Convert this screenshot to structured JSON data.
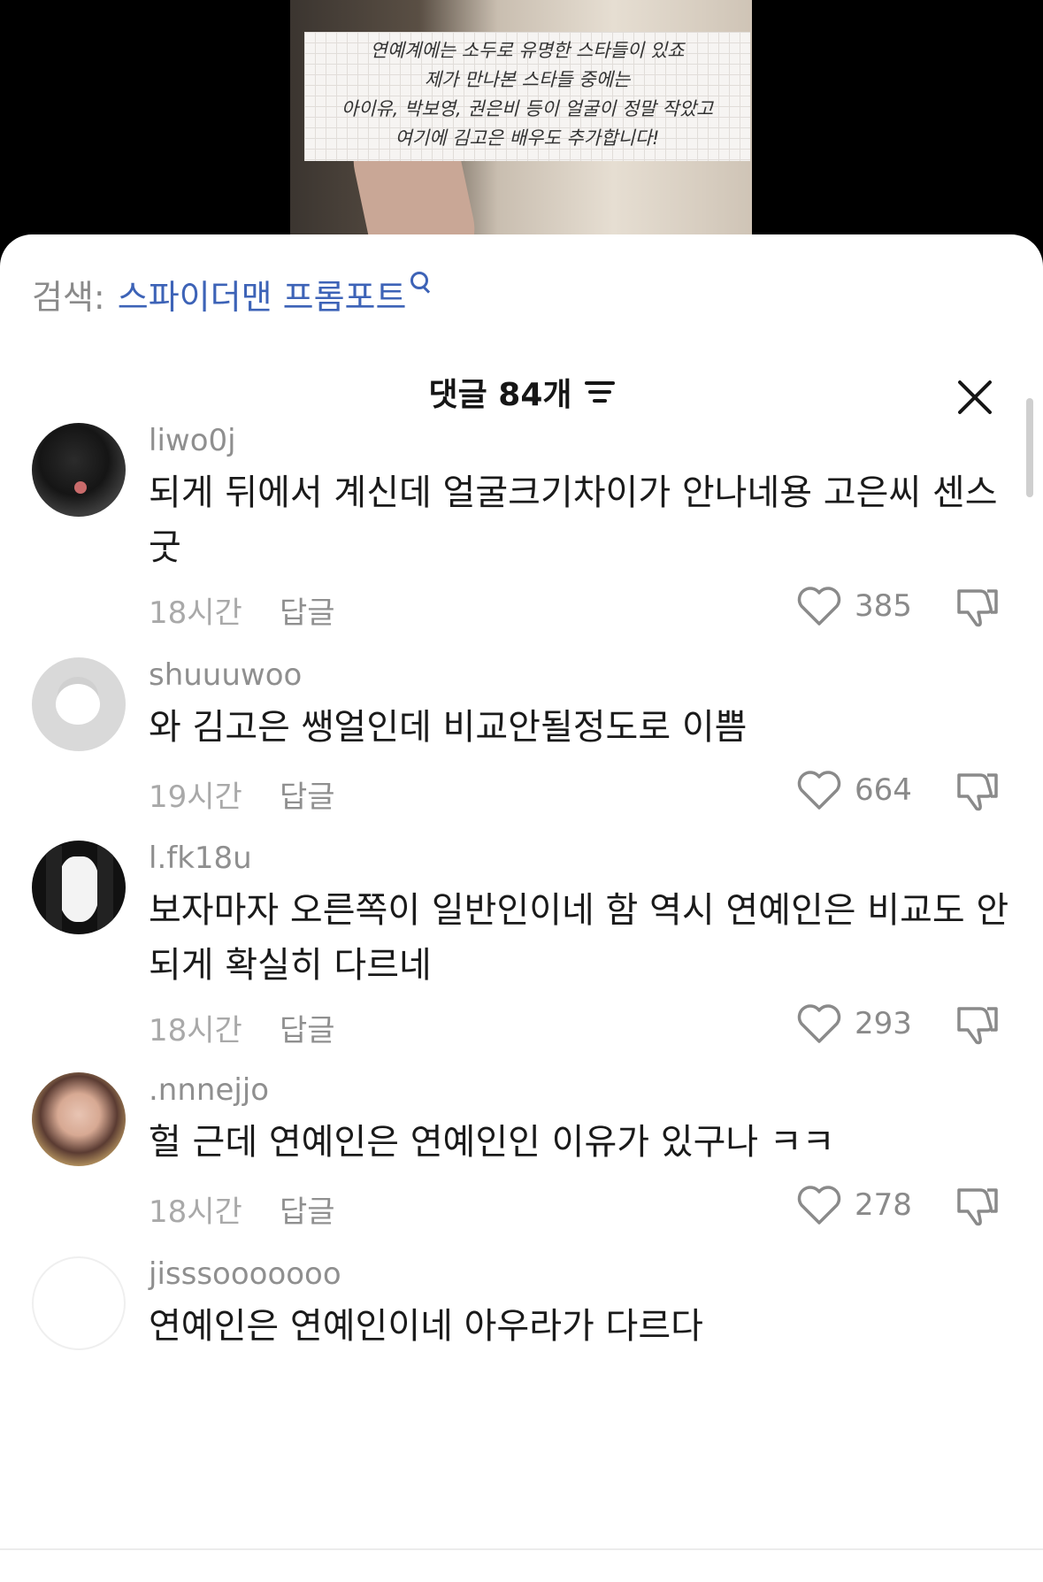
{
  "video": {
    "caption_lines": [
      "연예계에는 소두로 유명한 스타들이 있죠",
      "제가 만나본 스타들 중에는",
      "아이유, 박보영, 권은비 등이 얼굴이 정말 작았고",
      "여기에 김고은 배우도 추가합니다!"
    ]
  },
  "search": {
    "prefix": "검색:",
    "term": "스파이더맨 프롬포트",
    "icon": "search-icon"
  },
  "header": {
    "title": "댓글 84개",
    "filter_icon": "sort-filter-icon",
    "close_icon": "close-icon"
  },
  "comments": [
    {
      "username": "liwo0j",
      "text": "되게 뒤에서 계신데 얼굴크기차이가 안나네용 고은씨 센스 굿",
      "time": "18시간",
      "reply": "답글",
      "likes": "385"
    },
    {
      "username": "shuuuwoo",
      "text": "와 김고은 쌩얼인데 비교안될정도로 이쁨",
      "time": "19시간",
      "reply": "답글",
      "likes": "664"
    },
    {
      "username": "l.fk18u",
      "text": "보자마자 오른쪽이 일반인이네 함 역시 연예인은 비교도 안되게 확실히 다르네",
      "time": "18시간",
      "reply": "답글",
      "likes": "293"
    },
    {
      "username": ".nnnejjo",
      "text": "헐 근데 연예인은 연예인인 이유가 있구나 ㅋㅋ",
      "time": "18시간",
      "reply": "답글",
      "likes": "278"
    },
    {
      "username": "jisssooooooo",
      "text": "연예인은 연예인이네 아우라가 다르다"
    }
  ],
  "colors": {
    "accent_link": "#3d63b7",
    "text": "#1a1a1a",
    "muted": "#8f8f8f"
  }
}
